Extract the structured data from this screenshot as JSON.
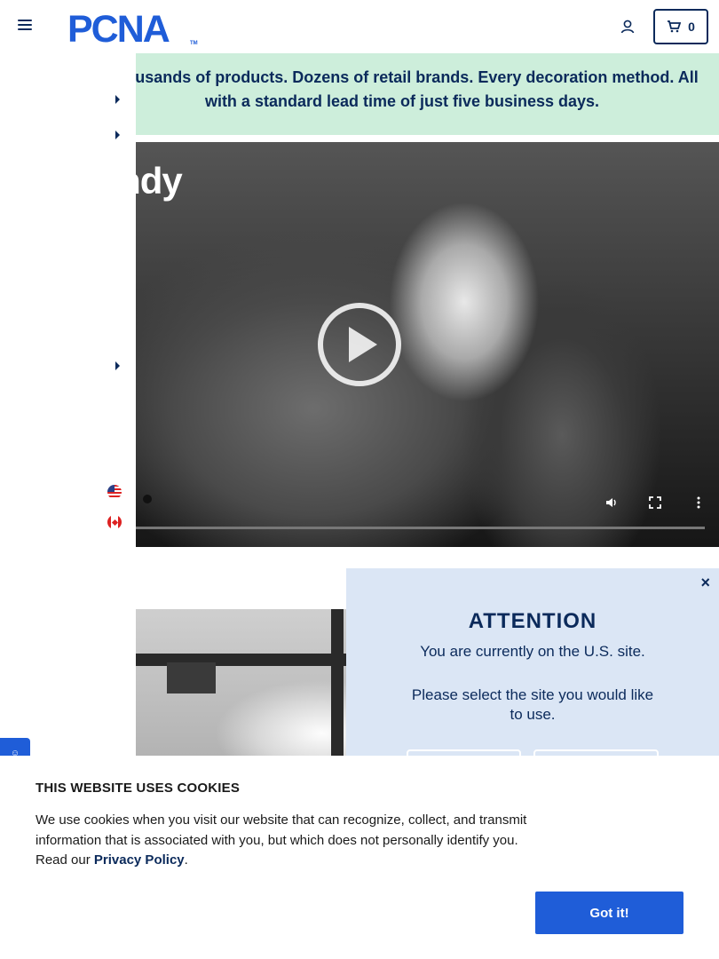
{
  "header": {
    "logo_text": "PCNA",
    "logo_tm": "TM",
    "cart_count": "0",
    "icons": [
      "menu-icon",
      "user-icon",
      "cart-icon"
    ]
  },
  "promo": {
    "text": "Thousands of products. Dozens of retail brands. Every decoration method. All with a standard lead time of just five business days."
  },
  "video": {
    "brand_text": "Skullcandy"
  },
  "region_modal": {
    "title": "ATTENTION",
    "message": "You are currently on the U.S. site.",
    "prompt": "Please select the site you would like to use.",
    "close_label": "×"
  },
  "cookie_banner": {
    "title": "THIS WEBSITE USES COOKIES",
    "text": "We use cookies when you visit our website that can recognize, collect, and transmit information that is associated with you, but which does not personally identify you. Read our",
    "link_label": "Privacy Policy",
    "suffix": ".",
    "button_label": "Got it!"
  },
  "colors": {
    "brand_navy": "#0b2a5b",
    "promo_bg": "#cdeedb",
    "modal_bg": "#dbe6f5",
    "cta_blue": "#1f5dd8"
  }
}
